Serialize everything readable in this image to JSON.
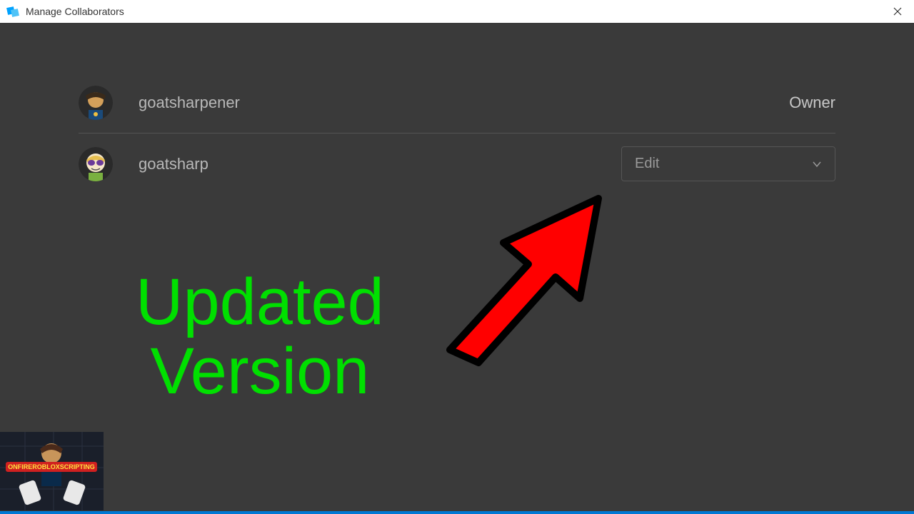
{
  "window": {
    "title": "Manage Collaborators"
  },
  "collaborators": [
    {
      "name": "goatsharpener",
      "role": "Owner"
    },
    {
      "name": "goatsharp",
      "permission": "Edit"
    }
  ],
  "annotation": {
    "line1": "Updated",
    "line2": "Version"
  }
}
